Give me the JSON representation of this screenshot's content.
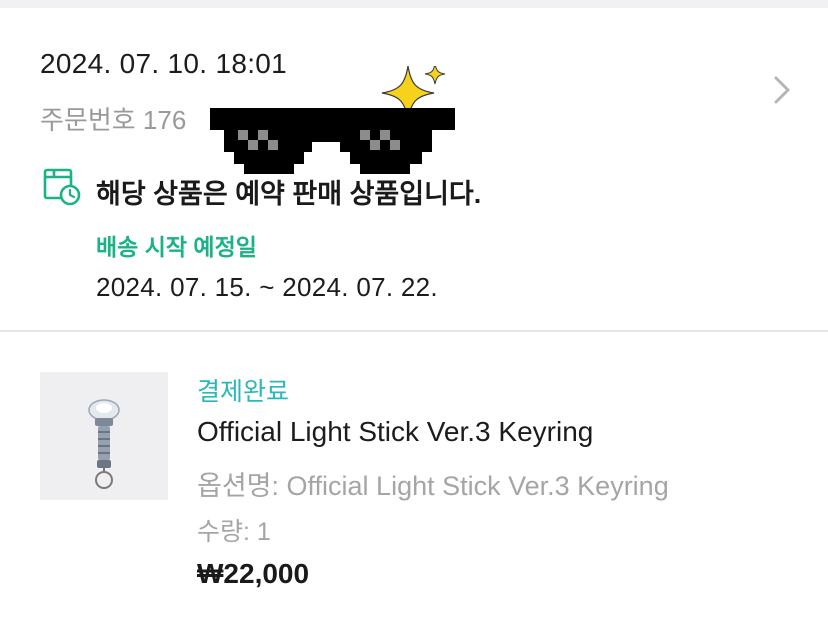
{
  "order": {
    "date": "2024. 07. 10. 18:01",
    "number_label": "주문번호",
    "number_visible": "176",
    "preorder_notice": "해당 상품은 예약 판매 상품입니다.",
    "shipping_label": "배송 시작 예정일",
    "shipping_range": "2024. 07. 15. ~ 2024. 07. 22."
  },
  "product": {
    "status": "결제완료",
    "name": "Official Light Stick Ver.3 Keyring",
    "option": "옵션명: Official Light Stick Ver.3 Keyring",
    "quantity": "수량: 1",
    "price": "₩22,000"
  },
  "icons": {
    "chevron": "chevron-right-icon",
    "preorder": "calendar-clock-icon",
    "redaction": "pixel-sunglasses-sticker"
  },
  "colors": {
    "accent_green": "#19b387",
    "status_teal": "#2ab9b6",
    "muted_gray": "#a5a5a5",
    "divider": "#e6e6e8"
  }
}
